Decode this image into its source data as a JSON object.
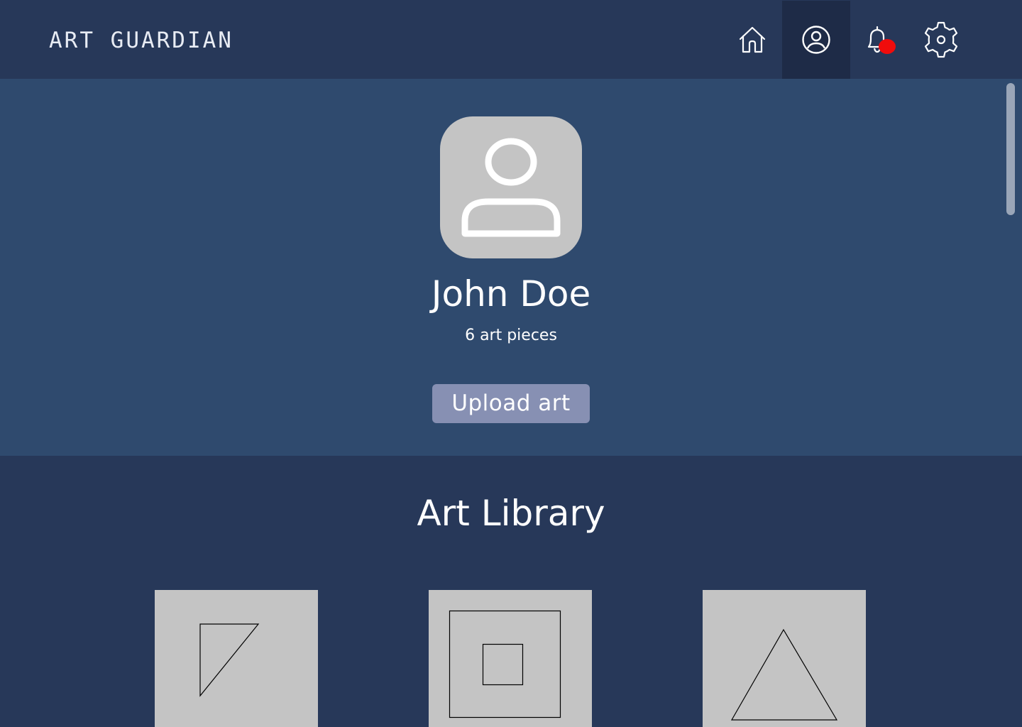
{
  "header": {
    "brand": "ART GUARDIAN",
    "nav": [
      {
        "name": "home",
        "icon": "home-icon"
      },
      {
        "name": "profile",
        "icon": "user-circle-icon",
        "active": true
      },
      {
        "name": "notifications",
        "icon": "bell-icon",
        "has_badge": true
      },
      {
        "name": "settings",
        "icon": "gear-icon"
      }
    ],
    "badge_color": "#f00c0c"
  },
  "profile": {
    "avatar_icon": "user-icon",
    "name": "John Doe",
    "art_count": "6 art pieces",
    "upload_label": "Upload art"
  },
  "library": {
    "title": "Art Library",
    "items": [
      {
        "icon": "triangle-sketch-icon"
      },
      {
        "icon": "nested-squares-icon"
      },
      {
        "icon": "triangle-icon"
      }
    ]
  },
  "colors": {
    "header_bg": "#273859",
    "profile_bg": "#2f4a6e",
    "active_nav_bg": "#1e2b47",
    "button_bg": "#8790b3",
    "tile_bg": "#c4c4c4"
  }
}
